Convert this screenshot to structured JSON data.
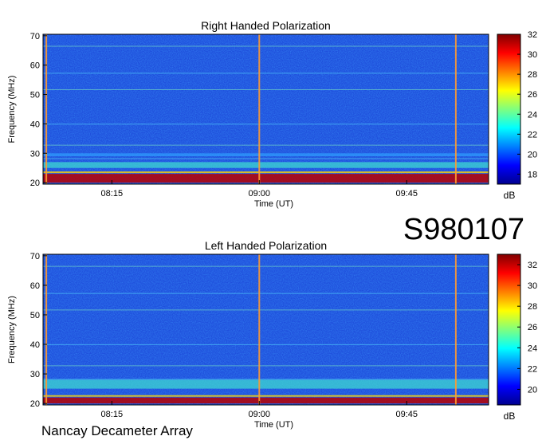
{
  "header": {
    "label": "S980107"
  },
  "footer": {
    "label": "Nancay Decameter Array"
  },
  "chart_data": [
    {
      "type": "heatmap",
      "title": "Right Handed Polarization",
      "xlabel": "Time (UT)",
      "ylabel": "Frequency (MHz)",
      "x_ticks": [
        "08:15",
        "09:00",
        "09:45"
      ],
      "y_ticks": [
        20,
        30,
        40,
        50,
        60,
        70
      ],
      "ylim": [
        19.5,
        70.5
      ],
      "colorbar": {
        "label": "dB",
        "ticks": [
          18,
          20,
          22,
          24,
          26,
          28,
          30,
          32
        ],
        "range": [
          17,
          32
        ]
      },
      "bright_bands_mhz": [
        [
          20,
          23
        ],
        [
          25,
          27
        ],
        [
          29,
          30
        ]
      ],
      "bright_lines_time": [
        "07:55",
        "09:00",
        "10:00"
      ]
    },
    {
      "type": "heatmap",
      "title": "Left Handed Polarization",
      "xlabel": "Time (UT)",
      "ylabel": "Frequency (MHz)",
      "x_ticks": [
        "08:15",
        "09:00",
        "09:45"
      ],
      "y_ticks": [
        20,
        30,
        40,
        50,
        60,
        70
      ],
      "ylim": [
        19.5,
        70.5
      ],
      "colorbar": {
        "label": "dB",
        "ticks": [
          20,
          22,
          24,
          26,
          28,
          30,
          32
        ],
        "range": [
          18.5,
          33
        ]
      },
      "bright_bands_mhz": [
        [
          20,
          22
        ],
        [
          25,
          28
        ]
      ],
      "bright_lines_time": [
        "07:55",
        "09:00",
        "10:00"
      ]
    }
  ]
}
